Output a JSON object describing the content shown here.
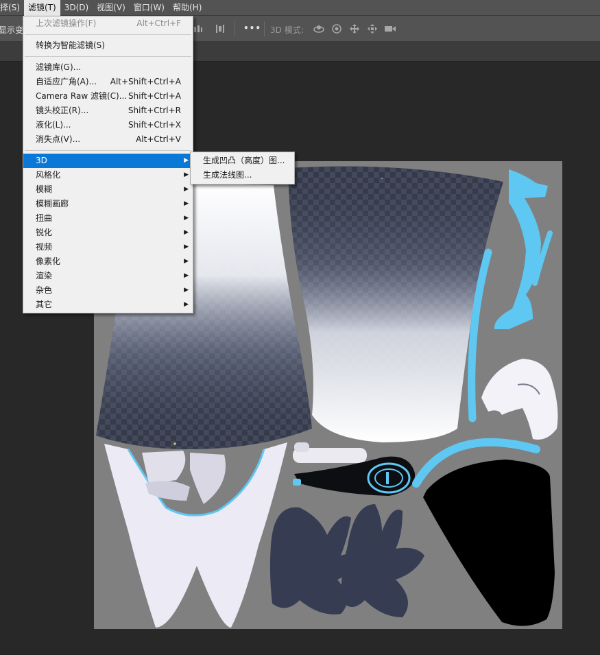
{
  "menubar": {
    "items": [
      {
        "label": "择(S)"
      },
      {
        "label": "滤镜(T)"
      },
      {
        "label": "3D(D)"
      },
      {
        "label": "视图(V)"
      },
      {
        "label": "窗口(W)"
      },
      {
        "label": "帮助(H)"
      }
    ]
  },
  "optbar": {
    "left_text": "显示变换",
    "mode_label": "3D 模式:",
    "more_glyph": "•••"
  },
  "filter_menu": {
    "last_filter": {
      "label": "上次滤镜操作(F)",
      "shortcut": "Alt+Ctrl+F"
    },
    "smart": {
      "label": "转换为智能滤镜(S)"
    },
    "gallery": {
      "label": "滤镜库(G)..."
    },
    "adaptive": {
      "label": "自适应广角(A)...",
      "shortcut": "Alt+Shift+Ctrl+A"
    },
    "camera_raw": {
      "label": "Camera Raw 滤镜(C)...",
      "shortcut": "Shift+Ctrl+A"
    },
    "lens": {
      "label": "镜头校正(R)...",
      "shortcut": "Shift+Ctrl+R"
    },
    "liquify": {
      "label": "液化(L)...",
      "shortcut": "Shift+Ctrl+X"
    },
    "vanishing": {
      "label": "消失点(V)...",
      "shortcut": "Alt+Ctrl+V"
    },
    "sub": [
      {
        "label": "3D"
      },
      {
        "label": "风格化"
      },
      {
        "label": "模糊"
      },
      {
        "label": "模糊画廊"
      },
      {
        "label": "扭曲"
      },
      {
        "label": "锐化"
      },
      {
        "label": "视频"
      },
      {
        "label": "像素化"
      },
      {
        "label": "渲染"
      },
      {
        "label": "杂色"
      },
      {
        "label": "其它"
      }
    ]
  },
  "submenu_3d": {
    "items": [
      {
        "label": "生成凹凸（高度）图..."
      },
      {
        "label": "生成法线图..."
      }
    ]
  },
  "colors": {
    "accent": "#0a78d7",
    "canvas_bg": "#808080",
    "cyan_part": "#5ec8f2",
    "dark_part": "#363c52"
  }
}
